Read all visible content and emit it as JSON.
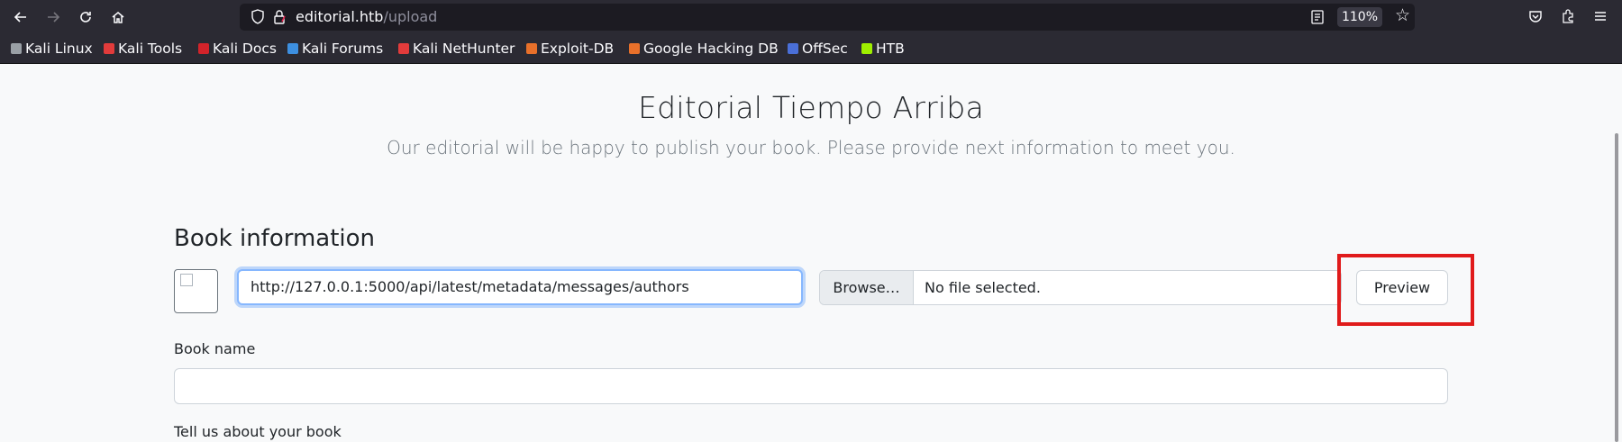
{
  "browser": {
    "url_host": "editorial.htb",
    "url_path": "/upload",
    "zoom": "110%",
    "icons": {
      "back": "arrow-left-icon",
      "forward": "arrow-right-icon",
      "reload": "reload-icon",
      "home": "home-icon",
      "shield": "shield-icon",
      "lock": "lock-icon",
      "reader": "reader-view-icon",
      "star": "star-icon",
      "pocket": "pocket-icon",
      "extensions": "extensions-icon",
      "menu": "hamburger-menu-icon"
    }
  },
  "bookmarks": [
    {
      "label": "Kali Linux",
      "color": "#9aa0a6"
    },
    {
      "label": "Kali Tools",
      "color": "#e23b3b"
    },
    {
      "label": "Kali Docs",
      "color": "#d2232a"
    },
    {
      "label": "Kali Forums",
      "color": "#3d8fe0"
    },
    {
      "label": "Kali NetHunter",
      "color": "#e23b3b"
    },
    {
      "label": "Exploit-DB",
      "color": "#e8702a"
    },
    {
      "label": "Google Hacking DB",
      "color": "#e8702a"
    },
    {
      "label": "OffSec",
      "color": "#4a6fd8"
    },
    {
      "label": "HTB",
      "color": "#9fef00"
    }
  ],
  "page": {
    "title": "Editorial Tiempo Arriba",
    "subtitle": "Our editorial will be happy to publish your book. Please provide next information to meet you.",
    "section_title": "Book information",
    "cover_url_value": "http://127.0.0.1:5000/api/latest/metadata/messages/authors",
    "browse_label": "Browse…",
    "file_status": "No file selected.",
    "preview_label": "Preview",
    "book_name_label": "Book name",
    "about_label": "Tell us about your book"
  },
  "colors": {
    "highlight": "#e01b1b",
    "focus_border": "#86b7fe"
  }
}
